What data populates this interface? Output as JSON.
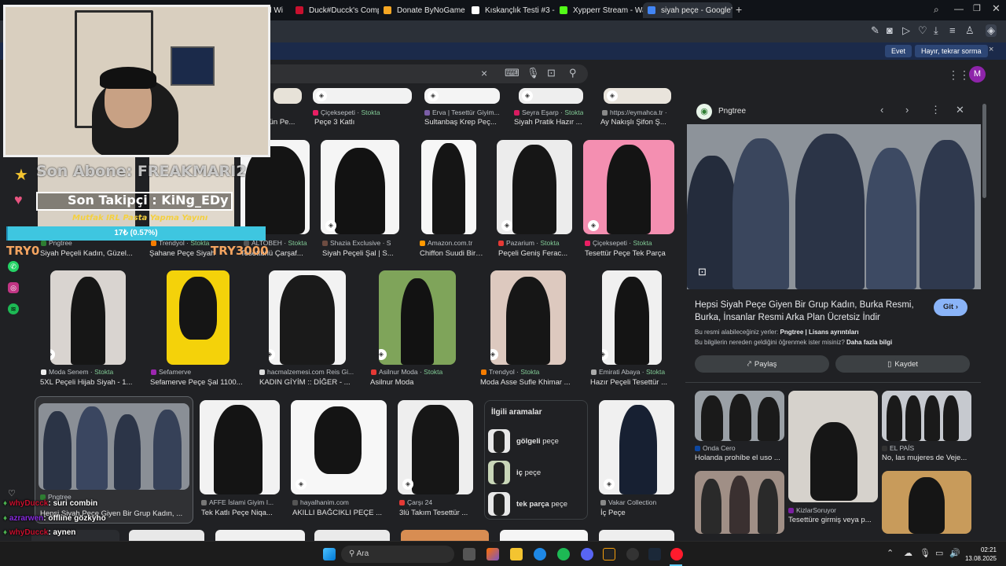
{
  "tabs": [
    {
      "label": "d Wi",
      "color": "#888888"
    },
    {
      "label": "Duck#Ducck's Competitiv",
      "color": "#c8102e"
    },
    {
      "label": "Donate ByNoGame - Stre",
      "color": "#f5a623"
    },
    {
      "label": "Kıskançlık Testi #3 - Quizel",
      "color": "#ffffff"
    },
    {
      "label": "Xypperr Stream - Watch L",
      "color": "#53fc18"
    },
    {
      "label": "siyah peçe - Google'da Ar",
      "color": "#4285f4"
    }
  ],
  "new_tab": "+",
  "infobar": {
    "yes": "Evet",
    "no": "Hayır, tekrar sorma",
    "close": "×"
  },
  "search": {
    "clear": "×",
    "avatar": "M"
  },
  "row0": [
    {
      "source": "",
      "stock": "",
      "title": "tün Pe..."
    },
    {
      "source": "Çiçeksepeti · ",
      "stock": "Stokta",
      "title": "Peçe 3 Katlı"
    },
    {
      "source": "Erva | Tesettür Giyim...",
      "stock": "",
      "title": "Sultanbaş Krep Peç..."
    },
    {
      "source": "Seyra Eşarp · ",
      "stock": "Stokta",
      "title": "Siyah Pratik Hazır ..."
    },
    {
      "source": "https://eymahca.tr · ",
      "stock": "",
      "title": "Ay Nakışlı Şifon Ş..."
    }
  ],
  "row1": [
    {
      "source": "Pngtree",
      "stock": "",
      "title": "Siyah Peçeli Kadın, Güzel..."
    },
    {
      "source": "Trendyol · ",
      "stock": "Stokta",
      "title": "Şahane Peçe Siyah"
    },
    {
      "source": "ALTOBEH · ",
      "stock": "Stokta",
      "title": "Tesettürlü Çarşaf..."
    },
    {
      "source": "Shazia Exclusive · S",
      "stock": "",
      "title": "Siyah Peçeli Şal | S..."
    },
    {
      "source": "Amazon.com.tr",
      "stock": "",
      "title": "Chiffon Suudi Birin..."
    },
    {
      "source": "Pazarium · ",
      "stock": "Stokta",
      "title": "Peçeli Geniş Ferac..."
    },
    {
      "source": "Çiçeksepeti · ",
      "stock": "Stokta",
      "title": "Tesettür Peçe Tek Parça"
    }
  ],
  "row2": [
    {
      "source": "Moda Senem · ",
      "stock": "Stokta",
      "title": "5XL Peçeli Hijab Siyah - 1..."
    },
    {
      "source": "Sefamerve",
      "stock": "",
      "title": "Sefamerve Peçe Şal 1100..."
    },
    {
      "source": "hacmalzemesi.com Reis Gi...",
      "stock": "",
      "title": "KADIN GİYİM :: DİĞER - ..."
    },
    {
      "source": "Asilnur Moda · ",
      "stock": "Stokta",
      "title": "Asilnur Moda"
    },
    {
      "source": "Trendyol · ",
      "stock": "Stokta",
      "title": "Moda Asse Sufle Khimar ..."
    },
    {
      "source": "Emirati Abaya · ",
      "stock": "Stokta",
      "title": "Hazır Peçeli Tesettür ..."
    }
  ],
  "row3": [
    {
      "source": "Pngtree",
      "stock": "",
      "title": "Hepsi Siyah Peçe Giyen Bir Grup Kadın, ..."
    },
    {
      "source": "AFFE İslami Giyim I...",
      "stock": "",
      "title": "Tek Katlı Peçe Niqa..."
    },
    {
      "source": "hayalhanim.com",
      "stock": "",
      "title": "AKILLI BAĞCIKLI PEÇE ..."
    },
    {
      "source": "Çarşı 24",
      "stock": "",
      "title": "3lü Takım Tesettür ..."
    },
    {
      "source": "Vakar Collection",
      "stock": "",
      "title": "İç Peçe"
    }
  ],
  "related": {
    "heading": "İlgili aramalar",
    "items": [
      {
        "bold": "gölgeli",
        "rest": " peçe"
      },
      {
        "bold": "iç",
        "rest": " peçe"
      },
      {
        "bold": "tek parça",
        "rest": " peçe"
      }
    ]
  },
  "panel": {
    "source": "Pngtree",
    "title": "Hepsi Siyah Peçe Giyen Bir Grup Kadın, Burka Resmi, Burka, İnsanlar Resmi Arka Plan Ücretsiz İndir",
    "visit": "Git",
    "license_prefix": "Bu resmi alabileceğiniz yerler: ",
    "license_bold": "Pngtree | Lisans ayrıntıları",
    "learn_prefix": "Bu bilgilerin nereden geldiğini öğrenmek ister misiniz? ",
    "learn_bold": "Daha fazla bilgi",
    "share": "Paylaş",
    "save": "Kaydet",
    "related": [
      {
        "source": "Onda Cero",
        "title": "Holanda prohíbe el uso ..."
      },
      {
        "source": "EL PAÍS",
        "title": "No, las mujeres de Veje..."
      },
      {
        "source": "KizlarSoruyor",
        "title": "Tesettüre girmiş veya p..."
      }
    ]
  },
  "overlay": {
    "last_sub": "Son Abone: FREAKMARI2",
    "last_follow": "Son Takipçi : KiNg_EDy",
    "ticker": "Mutfak IRL Pasta Yapma Yayını",
    "goal": "17₺ (0.57%)",
    "goal_left": "TRY0",
    "goal_right": "TRY3000",
    "goal_fraction": 0.0057,
    "chat": [
      {
        "user": "whyDucck",
        "msg": ": suri combin",
        "color": "#c8102e"
      },
      {
        "user": "azrarwen",
        "msg": ": offline gözkyho",
        "color": "#8a2be2"
      },
      {
        "user": "whyDucck",
        "msg": ": aynen",
        "color": "#c8102e"
      }
    ]
  },
  "taskbar": {
    "search": "Ara",
    "time": "02:21",
    "date": "13.08.2025"
  }
}
